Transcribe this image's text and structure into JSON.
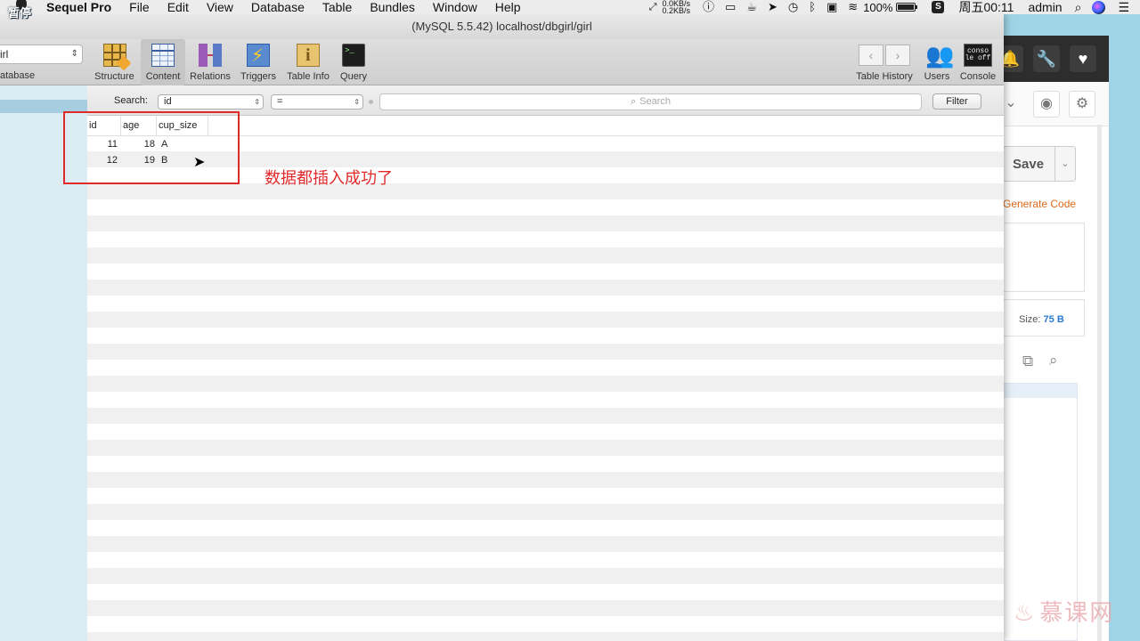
{
  "menubar": {
    "overlay_text": "暂停",
    "app_name": "Sequel Pro",
    "items": [
      "File",
      "Edit",
      "View",
      "Database",
      "Table",
      "Bundles",
      "Window",
      "Help"
    ],
    "net_up": "0.0KB/s",
    "net_down": "0.2KB/s",
    "battery": "100%",
    "clock": "周五00:11",
    "user": "admin",
    "status_icons": [
      "net-arrows-icon",
      "info-icon",
      "airplay-icon",
      "cup-icon",
      "location-icon",
      "time-machine-icon",
      "bluetooth-icon",
      "display-icon",
      "wifi-icon",
      "battery-icon",
      "s-app-icon",
      "spotlight-icon",
      "siri-icon",
      "notification-center-icon"
    ]
  },
  "window": {
    "title": "(MySQL 5.5.42) localhost/dbgirl/girl"
  },
  "toolbar": {
    "database_value": "irl",
    "database_label": "atabase",
    "tools": [
      {
        "label": "Structure",
        "icon": "structure-icon"
      },
      {
        "label": "Content",
        "icon": "content-icon",
        "active": true
      },
      {
        "label": "Relations",
        "icon": "relations-icon"
      },
      {
        "label": "Triggers",
        "icon": "triggers-icon"
      },
      {
        "label": "Table Info",
        "icon": "table-info-icon"
      },
      {
        "label": "Query",
        "icon": "query-icon"
      }
    ],
    "right_tools": [
      {
        "label": "Table History",
        "icon": "history-nav-icon"
      },
      {
        "label": "Users",
        "icon": "users-icon"
      },
      {
        "label": "Console",
        "icon": "console-icon",
        "icon_text_1": "conso",
        "icon_text_2": "le off"
      }
    ]
  },
  "filter": {
    "label": "Search:",
    "field": "id",
    "operator": "=",
    "placeholder": "Search",
    "button": "Filter"
  },
  "table": {
    "columns": [
      "id",
      "age",
      "cup_size"
    ],
    "rows": [
      [
        "11",
        "18",
        "A"
      ],
      [
        "12",
        "19",
        "B"
      ]
    ]
  },
  "annotation": {
    "text": "数据都插入成功了",
    "color": "#e02a2a"
  },
  "background_app": {
    "save_label": "Save",
    "generate_code": "Generate Code",
    "size_label": "Size:",
    "size_value": "75 B"
  },
  "watermark": "慕课网"
}
